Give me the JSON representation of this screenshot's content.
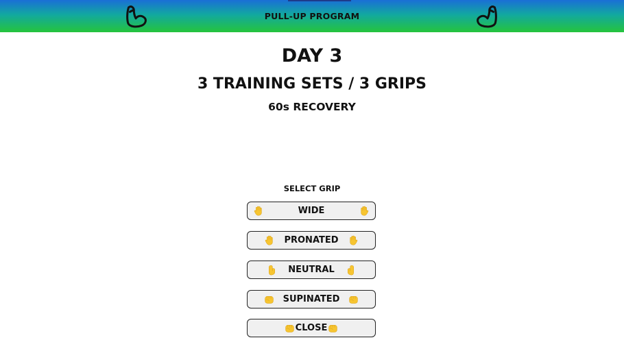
{
  "header": {
    "title": "PULL-UP PROGRAM",
    "left_icon": "flexed-bicep-icon",
    "right_icon": "flexed-bicep-icon"
  },
  "workout": {
    "day": "DAY 3",
    "sets": "3 TRAINING SETS / 3 GRIPS",
    "recovery": "60s RECOVERY"
  },
  "grip_selector": {
    "label": "SELECT GRIP",
    "options": [
      {
        "label": "WIDE",
        "icon": "raised-hand-icon"
      },
      {
        "label": "PRONATED",
        "icon": "raised-hand-icon"
      },
      {
        "label": "NEUTRAL",
        "icon": "side-hand-icon"
      },
      {
        "label": "SUPINATED",
        "icon": "fist-icon"
      }
    ],
    "close_label": "CLOSE",
    "close_icon": "fist-icon"
  },
  "colors": {
    "header_gradient_top": "#1a6fd6",
    "header_gradient_bottom": "#25c43c",
    "button_bg": "#f0f0f0",
    "emoji_yellow": "#f7c531"
  }
}
